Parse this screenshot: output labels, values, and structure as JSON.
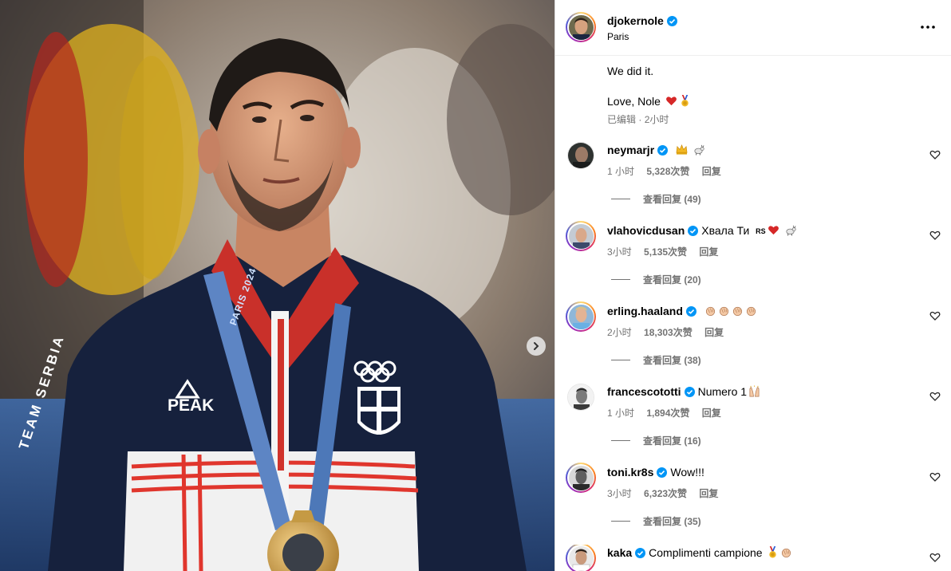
{
  "post": {
    "author": "djokernole",
    "location": "Paris",
    "caption_line1": "We did it.",
    "caption_line2": "Love, Nole",
    "edited_label": "已编辑",
    "separator": "·",
    "time_ago": "2小时",
    "photo_brand_text": "PEAK",
    "photo_jacket_text": "TEAM SERBIA",
    "photo_lanyard_text": "PARIS 2024"
  },
  "colors": {
    "verified_blue": "#0095f6",
    "secondary_text": "#737373",
    "divider": "#dbdbdb"
  },
  "icons": {
    "more": "more-horizontal-icon",
    "next": "chevron-right-icon",
    "like": "heart-outline-icon",
    "verified": "verified-badge-icon"
  },
  "comments": [
    {
      "username": "neymarjr",
      "text": "",
      "emojis": [
        "crown",
        "goat"
      ],
      "time": "1 小时",
      "likes": "5,328次赞",
      "reply": "回复",
      "replies": "查看回复 (49)"
    },
    {
      "username": "vlahovicdusan",
      "text": "Хвала Ти",
      "emojis": [
        "rs-flag",
        "red-heart",
        "goat"
      ],
      "time": "3小时",
      "likes": "5,135次赞",
      "reply": "回复",
      "replies": "查看回复 (20)"
    },
    {
      "username": "erling.haaland",
      "text": "",
      "emojis": [
        "clap",
        "clap",
        "clap",
        "clap"
      ],
      "time": "2小时",
      "likes": "18,303次赞",
      "reply": "回复",
      "replies": "查看回复 (38)"
    },
    {
      "username": "francescototti",
      "text": "Numero 1",
      "emojis": [
        "raising-hands"
      ],
      "time": "1 小时",
      "likes": "1,894次赞",
      "reply": "回复",
      "replies": "查看回复 (16)"
    },
    {
      "username": "toni.kr8s",
      "text": "Wow!!!",
      "emojis": [],
      "time": "3小时",
      "likes": "6,323次赞",
      "reply": "回复",
      "replies": "查看回复 (35)"
    },
    {
      "username": "kaka",
      "text": "Complimenti campione",
      "emojis": [
        "medal",
        "clap"
      ],
      "time": "",
      "likes": "",
      "reply": "",
      "replies": ""
    }
  ],
  "rs_flag_text": "RS"
}
